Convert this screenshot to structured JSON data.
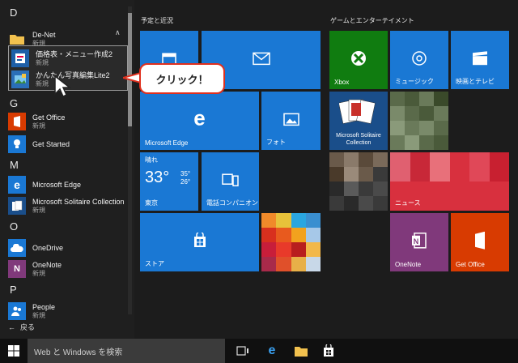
{
  "applist": {
    "letters": [
      "D",
      "G",
      "M",
      "O",
      "P"
    ],
    "folder": {
      "name": "De-Net",
      "sub": "新規"
    },
    "subitems": [
      {
        "name": "価格表・メニュー作成2",
        "sub": "新規"
      },
      {
        "name": "かんたん写真編集Lite2",
        "sub": "新規"
      }
    ],
    "g_items": [
      {
        "name": "Get Office",
        "sub": "新規"
      },
      {
        "name": "Get Started",
        "sub": ""
      }
    ],
    "m_items": [
      {
        "name": "Microsoft Edge",
        "sub": ""
      },
      {
        "name": "Microsoft Solitaire Collection",
        "sub": "新規"
      }
    ],
    "o_items": [
      {
        "name": "OneDrive",
        "sub": ""
      },
      {
        "name": "OneNote",
        "sub": "新規"
      }
    ],
    "p_items": [
      {
        "name": "People",
        "sub": "新規"
      }
    ],
    "back_label": "戻る"
  },
  "callout": {
    "text": "クリック！"
  },
  "sections": {
    "left_title": "予定と近況",
    "right_title": "ゲームとエンターテイメント"
  },
  "tiles": {
    "edge": "Microsoft Edge",
    "photos": "フォト",
    "weather": {
      "title": "晴れ",
      "temp": "33°",
      "hi": "35°",
      "lo": "26°",
      "city": "東京"
    },
    "phone": "電話コンパニオン",
    "store": "ストア",
    "xbox": "Xbox",
    "groove": "ミュージック",
    "movies": "映画とテレビ",
    "solitaire": "Microsoft Solitaire Collection",
    "news": "ニュース",
    "onenote": "OneNote",
    "getoffice": "Get Office"
  },
  "taskbar": {
    "search_placeholder": "Web と Windows を検索"
  },
  "colors": {
    "tile_blue": "#1a78d4",
    "xbox_green": "#107c10",
    "news_red": "#d8303e",
    "onenote_purple": "#80397b",
    "office_orange": "#d83b01",
    "callout_red": "#e0301e"
  }
}
